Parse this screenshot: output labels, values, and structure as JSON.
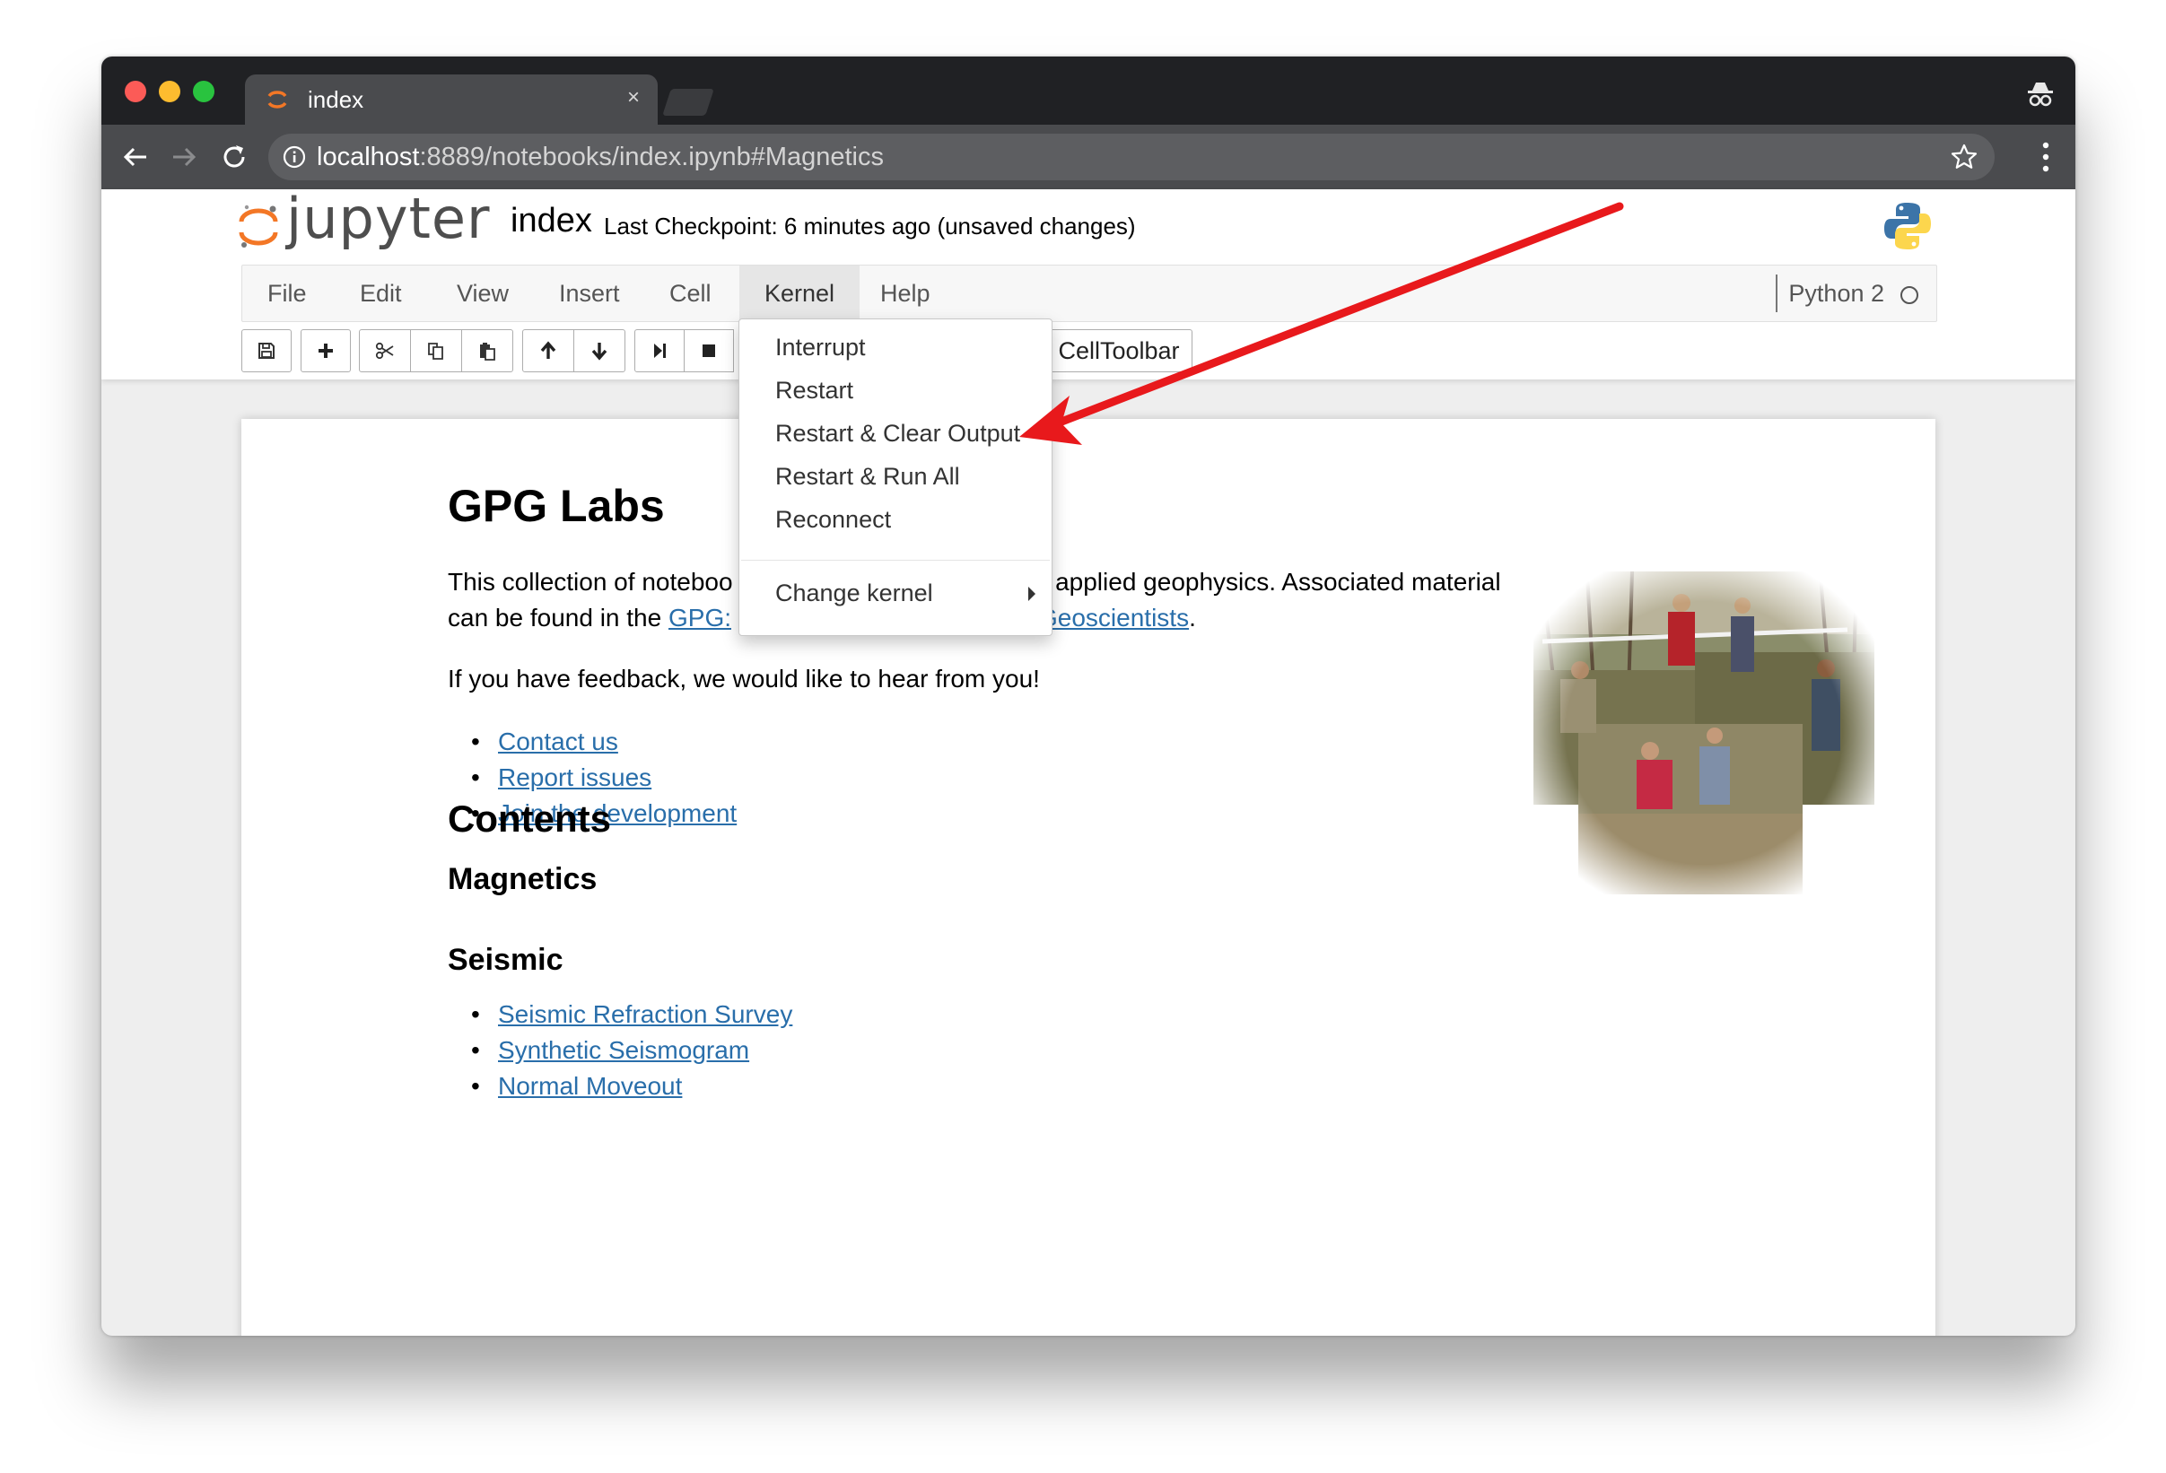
{
  "browser": {
    "tab_title": "index",
    "tab_close": "×",
    "url_host": "localhost",
    "url_rest": ":8889/notebooks/index.ipynb#Magnetics",
    "icons": [
      "back-arrow-icon",
      "forward-arrow-icon",
      "reload-icon",
      "info-icon",
      "star-icon",
      "kebab-menu-icon",
      "incognito-icon"
    ]
  },
  "jupyter": {
    "logo_text": "jupyter",
    "notebook_name": "index",
    "checkpoint": "Last Checkpoint: 6 minutes ago (unsaved changes)",
    "menu": [
      "File",
      "Edit",
      "View",
      "Insert",
      "Cell",
      "Kernel",
      "Help"
    ],
    "kernel_name": "Python 2",
    "toolbar_icons": [
      "save-icon",
      "plus-icon",
      "cut-icon",
      "copy-icon",
      "paste-icon",
      "arrow-up-icon",
      "arrow-down-icon",
      "run-step-icon",
      "stop-icon",
      "keyboard-icon"
    ],
    "celltoolbar_label": "CellToolbar",
    "accent_color": "#f37726"
  },
  "kernel_menu": {
    "items": [
      "Interrupt",
      "Restart",
      "Restart & Clear Output",
      "Restart & Run All",
      "Reconnect"
    ],
    "submenu": "Change kernel"
  },
  "notebook": {
    "title": "GPG Labs",
    "intro_line1_a": "This collection of noteboo",
    "intro_line1_b": "f applied geophysics. Associated material",
    "intro_line2_a": "can be found in the ",
    "intro_link_a": "GPG:",
    "intro_link_b": "Geoscientists",
    "intro_line2_end": ".",
    "feedback": "If you have feedback, we would like to hear from you!",
    "feedback_links": [
      "Contact us",
      "Report issues",
      "Join the development"
    ],
    "contents_title": "Contents",
    "magnetics_title": "Magnetics",
    "seismic_title": "Seismic",
    "seismic_links": [
      "Seismic Refraction Survey",
      "Synthetic Seismogram",
      "Normal Moveout"
    ]
  },
  "annotation": {
    "arrow_color": "#e8191c"
  }
}
